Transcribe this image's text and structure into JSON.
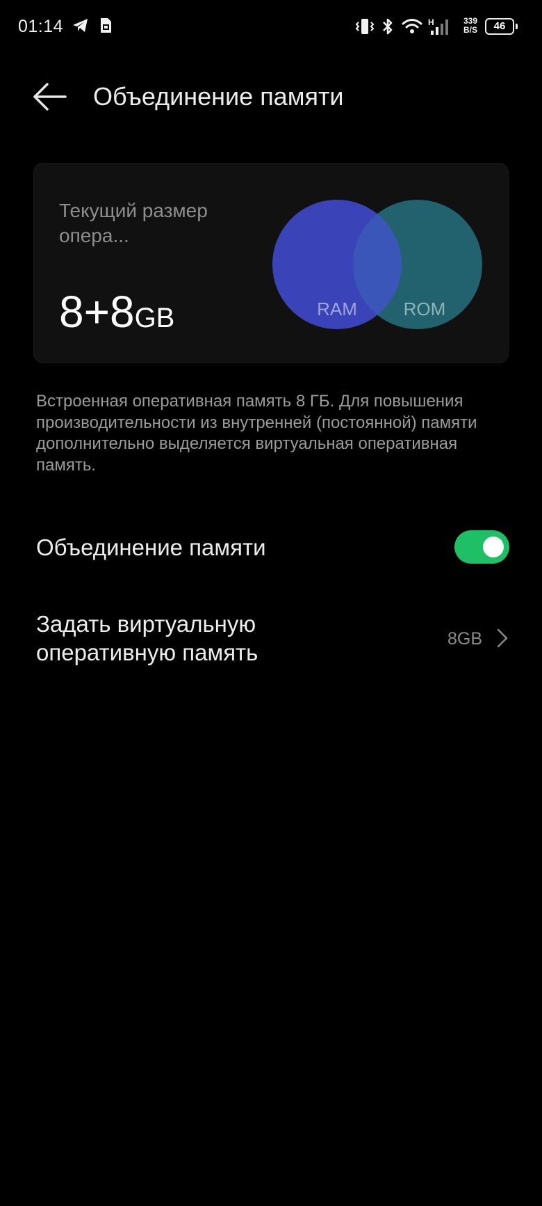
{
  "status_bar": {
    "time": "01:14",
    "net_speed_value": "339",
    "net_speed_unit": "B/S",
    "network_type": "H",
    "battery": "46",
    "icons": [
      "telegram-icon",
      "sim-card-icon",
      "vibrate-icon",
      "bluetooth-icon",
      "wifi-icon",
      "signal-icon",
      "battery-icon"
    ]
  },
  "header": {
    "title": "Объединение памяти"
  },
  "card": {
    "label": "Текущий размер опера...",
    "value_number": "8+8",
    "value_unit": "GB",
    "venn_left_label": "RAM",
    "venn_right_label": "ROM",
    "colors": {
      "ram": "#3b43b8",
      "rom": "#22626e",
      "overlap": "#3a56b8"
    }
  },
  "description": "Встроенная оперативная память 8 ГБ. Для повышения производительности из внутренней (постоянной) памяти дополнительно выделяется виртуальная оперативная память.",
  "settings": {
    "merge_label": "Объединение памяти",
    "merge_enabled": true,
    "toggle_color": "#1fbf66",
    "virtual_label": "Задать виртуальную оперативную память",
    "virtual_value": "8GB"
  }
}
